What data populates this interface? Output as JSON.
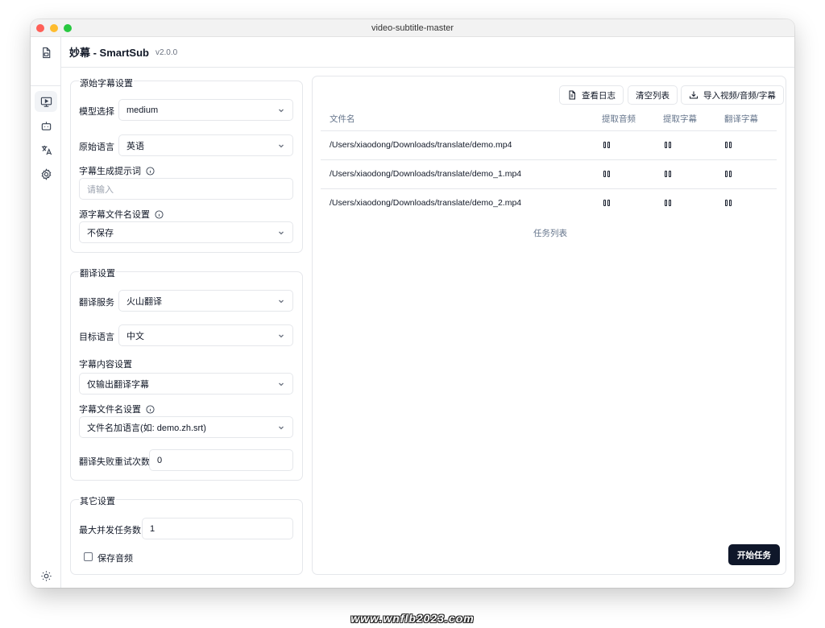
{
  "window": {
    "title": "video-subtitle-master"
  },
  "app": {
    "name": "妙幕 - SmartSub",
    "version": "v2.0.0"
  },
  "sidebar": {
    "items": [
      {
        "name": "logo-file-icon",
        "icon": "file-subtitle-icon"
      },
      {
        "name": "video-icon",
        "icon": "monitor-play-icon"
      },
      {
        "name": "bot-icon",
        "icon": "bot-icon"
      },
      {
        "name": "translate-icon",
        "icon": "languages-icon"
      },
      {
        "name": "settings-icon",
        "icon": "gear-icon"
      }
    ],
    "bottom": [
      "sun-icon",
      "github-icon"
    ]
  },
  "source_settings": {
    "title": "源始字幕设置",
    "model_label": "模型选择",
    "model_value": "medium",
    "language_label": "原始语言",
    "language_value": "英语",
    "prompt_label": "字幕生成提示词",
    "prompt_placeholder": "请输入",
    "filename_label": "源字幕文件名设置",
    "filename_value": "不保存"
  },
  "translate_settings": {
    "title": "翻译设置",
    "service_label": "翻译服务",
    "service_value": "火山翻译",
    "target_label": "目标语言",
    "target_value": "中文",
    "content_label": "字幕内容设置",
    "content_value": "仅输出翻译字幕",
    "filename_label": "字幕文件名设置",
    "filename_value": "文件名加语言(如: demo.zh.srt)",
    "retry_label": "翻译失败重试次数",
    "retry_value": "0"
  },
  "other_settings": {
    "title": "其它设置",
    "concurrency_label": "最大并发任务数",
    "concurrency_value": "1",
    "save_audio_label": "保存音频",
    "save_audio_checked": false
  },
  "toolbar": {
    "view_log": "查看日志",
    "clear_list": "清空列表",
    "import": "导入视频/音频/字幕"
  },
  "table": {
    "headers": [
      "文件名",
      "提取音频",
      "提取字幕",
      "翻译字幕"
    ],
    "rows": [
      {
        "file": "/Users/xiaodong/Downloads/translate/demo.mp4"
      },
      {
        "file": "/Users/xiaodong/Downloads/translate/demo_1.mp4"
      },
      {
        "file": "/Users/xiaodong/Downloads/translate/demo_2.mp4"
      }
    ],
    "caption": "任务列表"
  },
  "actions": {
    "start": "开始任务"
  },
  "watermark": "www.wnflb2023.com"
}
